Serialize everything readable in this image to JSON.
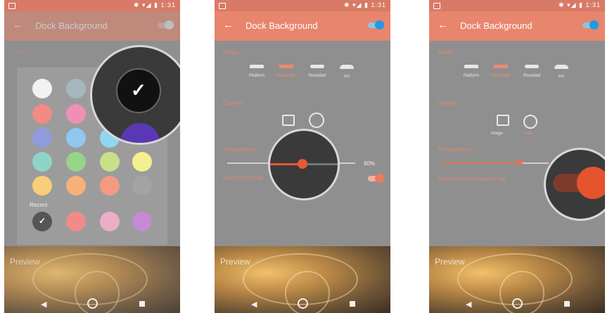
{
  "status": {
    "time": "1:31",
    "icons": "✱ ▾◢ ▮"
  },
  "screens": [
    {
      "title": "Dock Background",
      "back": "←"
    },
    {
      "title": "Dock Background",
      "back": "←"
    },
    {
      "title": "Dock Background",
      "back": "←"
    }
  ],
  "sections": {
    "shape": "Shape",
    "content": "Content",
    "transparency": "Transparency",
    "draw_behind": "Draw behind navigation bar",
    "draw_behind_short": "Draw behind na"
  },
  "shapes": [
    "Platform",
    "Rectangle",
    "Rounded",
    "Arc"
  ],
  "content_options": {
    "image": "Image",
    "color": "Color"
  },
  "transparency_value": "60%",
  "transparency_level": 0.6,
  "preview_label": "Preview",
  "recent_label": "Recent",
  "colors": {
    "accent": "#e7856d",
    "swatches": [
      "#f2f2f2",
      "#a6b6bd",
      "#f28a86",
      "#ef8fb6",
      "#8f9bdc",
      "#8fc7f1",
      "#8fd4c8",
      "#95d48a",
      "#c8e08a",
      "#f4ef8f",
      "#f8cf78",
      "#f7b078",
      "#f49a82"
    ],
    "recent": [
      "#f08b87",
      "#ecadc7",
      "#c68ad3"
    ],
    "selected_purple": "#5a38b5",
    "toggle_on": "#1e9be5"
  },
  "icons": [
    "back-arrow-icon",
    "toggle-switch",
    "image-icon",
    "check-icon",
    "triangle-back-icon",
    "home-circle-icon",
    "square-recents-icon"
  ]
}
